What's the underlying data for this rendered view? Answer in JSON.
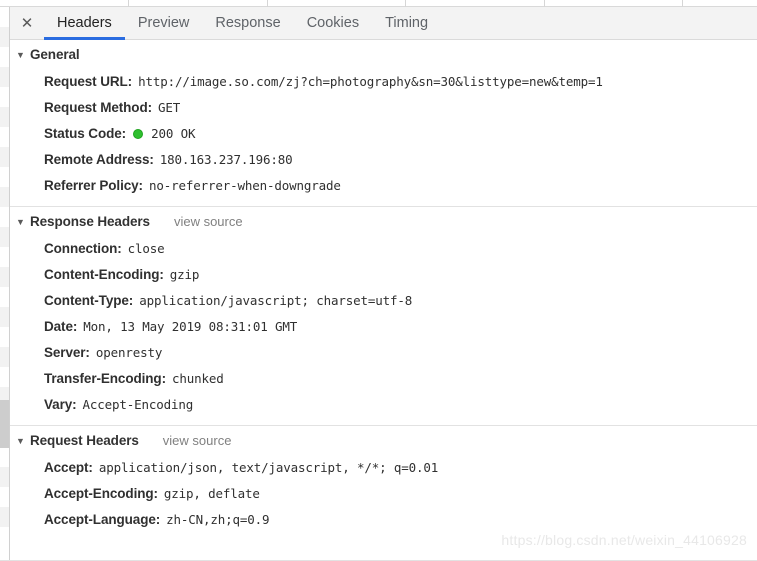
{
  "window": {
    "close_icon": "close-icon"
  },
  "tabs": [
    {
      "label": "Headers",
      "active": true
    },
    {
      "label": "Preview",
      "active": false
    },
    {
      "label": "Response",
      "active": false
    },
    {
      "label": "Cookies",
      "active": false
    },
    {
      "label": "Timing",
      "active": false
    }
  ],
  "colors": {
    "accent": "#2a6ce0",
    "status_ok": "#2fbf2f",
    "tabbar_bg": "#f3f3f3",
    "divider": "#e2e2e2"
  },
  "sections": [
    {
      "title": "General",
      "twisty": "▼",
      "view_source": null,
      "rows": [
        {
          "key": "Request URL:",
          "value": "http://image.so.com/zj?ch=photography&sn=30&listtype=new&temp=1"
        },
        {
          "key": "Request Method:",
          "value": "GET"
        },
        {
          "key": "Status Code:",
          "value": "200 OK",
          "status_dot": true
        },
        {
          "key": "Remote Address:",
          "value": "180.163.237.196:80"
        },
        {
          "key": "Referrer Policy:",
          "value": "no-referrer-when-downgrade"
        }
      ]
    },
    {
      "title": "Response Headers",
      "twisty": "▼",
      "view_source": "view source",
      "rows": [
        {
          "key": "Connection:",
          "value": "close"
        },
        {
          "key": "Content-Encoding:",
          "value": "gzip"
        },
        {
          "key": "Content-Type:",
          "value": "application/javascript; charset=utf-8"
        },
        {
          "key": "Date:",
          "value": "Mon, 13 May 2019 08:31:01 GMT"
        },
        {
          "key": "Server:",
          "value": "openresty"
        },
        {
          "key": "Transfer-Encoding:",
          "value": "chunked"
        },
        {
          "key": "Vary:",
          "value": "Accept-Encoding"
        }
      ]
    },
    {
      "title": "Request Headers",
      "twisty": "▼",
      "view_source": "view source",
      "rows": [
        {
          "key": "Accept:",
          "value": "application/json, text/javascript, */*; q=0.01"
        },
        {
          "key": "Accept-Encoding:",
          "value": "gzip, deflate"
        },
        {
          "key": "Accept-Language:",
          "value": "zh-CN,zh;q=0.9"
        }
      ]
    }
  ],
  "watermark": "https://blog.csdn.net/weixin_44106928"
}
